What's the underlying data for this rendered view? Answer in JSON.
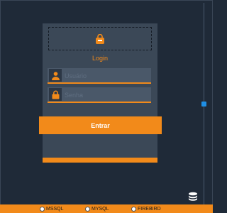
{
  "login": {
    "title": "Login",
    "username_placeholder": "Usuário",
    "password_placeholder": "Senha",
    "submit_label": "Entrar"
  },
  "icons": {
    "logo": "lock-logo-icon",
    "username": "user-icon",
    "password": "lock-icon",
    "database": "database-icon"
  },
  "database_options": {
    "mssql": "MSSQL",
    "mysql": "MYSQL",
    "firebird": "FIREBIRD"
  },
  "colors": {
    "background": "#1f2a38",
    "panel": "#3b4857",
    "accent": "#f28a1a",
    "scroll_handle": "#1f8fe5"
  }
}
